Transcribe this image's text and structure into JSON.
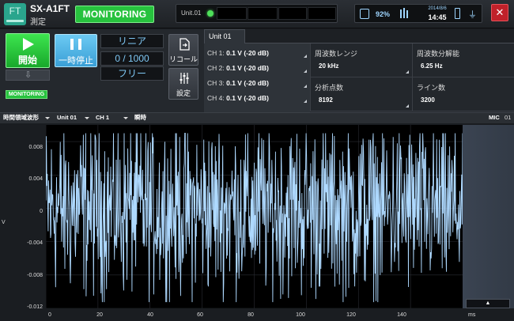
{
  "app": {
    "logo": "FT",
    "name": "SX-A1FT",
    "mode": "測定"
  },
  "top": {
    "monitoring_label": "MONITORING",
    "unit_label": "Unit.01",
    "battery_pct": "92%",
    "date": "2014/8/6",
    "time": "14:45",
    "colors": {
      "accent_green": "#27c23e",
      "close_red": "#c0212a",
      "waveform": "#aed9ff",
      "pause_blue": "#4aaee2"
    }
  },
  "controls": {
    "start_label": "開始",
    "pause_label": "一時停止",
    "monitoring_small": "MONITORING",
    "mode1": "リニア",
    "mode2": "0 / 1000",
    "mode3": "フリー",
    "recall_label": "リコール",
    "settings_label": "設定"
  },
  "unit_tab": "Unit 01",
  "channels": [
    {
      "label": "CH 1:",
      "value": "0.1 V (-20 dB)"
    },
    {
      "label": "CH 2:",
      "value": "0.1 V (-20 dB)"
    },
    {
      "label": "CH 3:",
      "value": "0.1 V (-20 dB)"
    },
    {
      "label": "CH 4:",
      "value": "0.1 V (-20 dB)"
    }
  ],
  "params": {
    "freq_range_label": "周波数レンジ",
    "freq_range_value": "20 kHz",
    "freq_res_label": "周波数分解能",
    "freq_res_value": "6.25 Hz",
    "points_label": "分析点数",
    "points_value": "8192",
    "lines_label": "ライン数",
    "lines_value": "3200"
  },
  "viewbar": {
    "view": "時間領域波形",
    "unit": "Unit 01",
    "channel": "CH 1",
    "mode": "瞬時",
    "mic": "MIC",
    "mic_num": "01"
  },
  "chart_data": {
    "type": "line",
    "ylabel": "V",
    "xlabel": "ms",
    "xlim": [
      0,
      160
    ],
    "ylim": [
      -0.012,
      0.01
    ],
    "yticks": [
      "0.008",
      "0.004",
      "0",
      "-0.004",
      "-0.008",
      "-0.012"
    ],
    "xticks": [
      "0",
      "20",
      "40",
      "60",
      "80",
      "100",
      "120",
      "140"
    ],
    "series": [
      {
        "description": "random noise waveform",
        "amplitude_approx": 0.009,
        "center": 0
      }
    ]
  },
  "icons": {
    "start": "play-icon",
    "pause": "pause-icon",
    "recall": "document-recall-icon",
    "settings": "sliders-icon",
    "close": "close-icon",
    "up": "triangle-up-icon"
  }
}
